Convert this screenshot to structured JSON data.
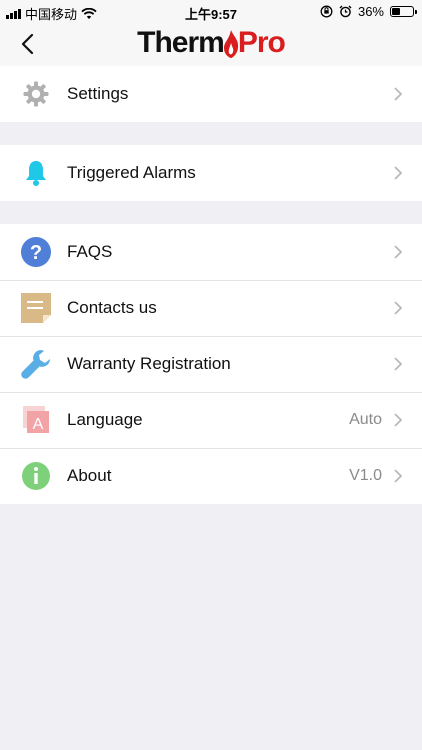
{
  "status_bar": {
    "carrier": "中国移动",
    "time": "上午9:57",
    "battery": "36%",
    "battery_level": 0.36
  },
  "nav": {
    "logo_part1": "Therm",
    "logo_part2": "Pro",
    "back_icon": "chevron-left-icon"
  },
  "groups": [
    {
      "items": [
        {
          "label": "Settings",
          "icon": "gear-icon",
          "value": ""
        }
      ]
    },
    {
      "items": [
        {
          "label": "Triggered Alarms",
          "icon": "bell-icon",
          "value": ""
        }
      ]
    },
    {
      "items": [
        {
          "label": "FAQS",
          "icon": "question-icon",
          "value": ""
        },
        {
          "label": "Contacts us",
          "icon": "note-icon",
          "value": ""
        },
        {
          "label": "Warranty Registration",
          "icon": "wrench-icon",
          "value": ""
        },
        {
          "label": "Language",
          "icon": "language-icon",
          "value": "Auto"
        },
        {
          "label": "About",
          "icon": "info-icon",
          "value": "V1.0"
        }
      ]
    }
  ],
  "colors": {
    "background": "#efeff4",
    "accent_red": "#d81e1e",
    "bell": "#1ec8e6",
    "faq": "#4f7fd6",
    "note": "#d9b986",
    "wrench": "#5aaee6",
    "language": "#f2a3a6",
    "info": "#7ed07a",
    "gear": "#b0b0b0"
  }
}
